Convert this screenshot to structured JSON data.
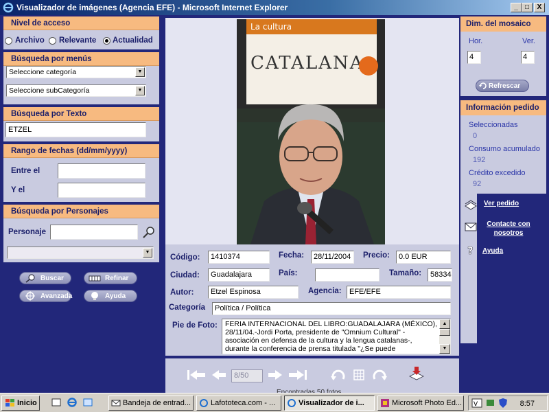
{
  "window": {
    "title": "Visualizador de imágenes (Agencia EFE) - Microsoft Internet Explorer",
    "buttons": {
      "min": "_",
      "max": "□",
      "close": "X"
    }
  },
  "left": {
    "acceso": {
      "title": "Nivel de acceso",
      "options": [
        "Archivo",
        "Relevante",
        "Actualidad"
      ],
      "selected": "Actualidad"
    },
    "menus": {
      "title": "Búsqueda por menús",
      "category": "Seleccione categoría",
      "subcategory": "Seleccione subCategoría"
    },
    "texto": {
      "title": "Búsqueda por Texto",
      "value": "ETZEL"
    },
    "fechas": {
      "title": "Rango de fechas (dd/mm/yyyy)",
      "entre_label": "Entre el",
      "y_label": "Y el",
      "entre_value": "",
      "y_value": ""
    },
    "personajes": {
      "title": "Búsqueda por Personajes",
      "label": "Personaje",
      "value": "",
      "select_value": ""
    },
    "buttons": {
      "buscar": "Buscar",
      "refinar": "Refinar",
      "avanzada": "Avanzada",
      "ayuda": "Ayuda"
    }
  },
  "photo": {
    "book_title": "La cultura",
    "book_word": "CATALANA"
  },
  "details": {
    "codigo_label": "Código:",
    "codigo": "1410374",
    "fecha_label": "Fecha:",
    "fecha": "28/11/2004",
    "precio_label": "Precio:",
    "precio": "0.0 EUR",
    "ciudad_label": "Ciudad:",
    "ciudad": "Guadalajara",
    "pais_label": "País:",
    "pais": "",
    "tamano_label": "Tamaño:",
    "tamano": "58334",
    "autor_label": "Autor:",
    "autor": "Etzel Espinosa",
    "agencia_label": "Agencia:",
    "agencia": "EFE/EFE",
    "categoria_label": "Categoría",
    "categoria": "Política / Política",
    "pie_label": "Pie de Foto:",
    "pie": "FERIA INTERNACIONAL DEL LIBRO:GUADALAJARA (MÉXICO), 28/11/04.-Jordi Porta, presidente de \"Omnium Cultural\" -asociación en defensa de la cultura y la lengua catalanas-, durante la conferencia de prensa titulada \"¿Se puede"
  },
  "nav": {
    "page": "8/50",
    "encontradas": "Encontradas 50 fotos"
  },
  "right": {
    "mosaico": {
      "title": "Dim. del mosaico",
      "hor_label": "Hor.",
      "ver_label": "Ver.",
      "hor": "4",
      "ver": "4",
      "refresh": "Refrescar"
    },
    "pedido": {
      "title": "Información pedido",
      "seleccionadas_label": "Seleccionadas",
      "seleccionadas": "0",
      "consumo_label": "Consumo acumulado",
      "consumo": "192",
      "credito_label": "Crédito excedido",
      "credito": "92"
    },
    "links": {
      "ver_pedido": "Ver pedido",
      "contacte": "Contacte con nosotros",
      "ayuda": "Ayuda"
    }
  },
  "taskbar": {
    "start": "Inicio",
    "tasks": [
      "Bandeja de entrad...",
      "Lafototeca.com - ...",
      "Visualizador de i...",
      "Microsoft Photo Ed..."
    ],
    "clock": "8:57"
  }
}
